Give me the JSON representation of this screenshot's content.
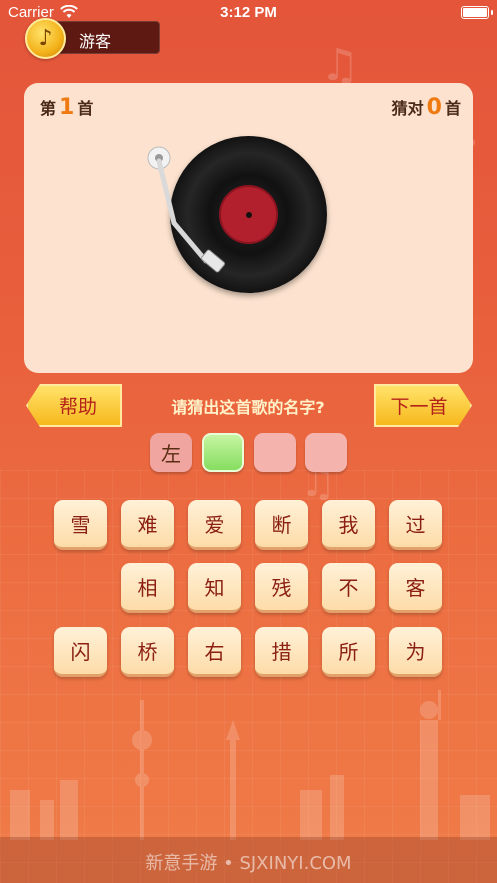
{
  "status_bar": {
    "carrier": "Carrier",
    "time": "3:12 PM"
  },
  "user": {
    "name": "游客",
    "avatar_icon": "music-note-icon"
  },
  "panel": {
    "current_prefix": "第",
    "current_number": "1",
    "current_suffix": "首",
    "correct_prefix": "猜对",
    "correct_number": "0",
    "correct_suffix": "首"
  },
  "controls": {
    "help_label": "帮助",
    "question": "请猜出这首歌的名字?",
    "next_label": "下一首"
  },
  "answer_slots": [
    "左",
    "",
    "",
    ""
  ],
  "tiles": {
    "row1": [
      "雪",
      "难",
      "爱",
      "断",
      "我",
      "过"
    ],
    "row2": [
      "相",
      "知",
      "残",
      "不",
      "客"
    ],
    "row3": [
      "闪",
      "桥",
      "右",
      "措",
      "所",
      "为"
    ]
  },
  "watermark": "新意手游 • SJXINYI.COM",
  "colors": {
    "accent_orange": "#f07a12",
    "button_yellow": "#f7b81c",
    "panel_bg": "#fde3cf",
    "active_slot_green": "#86dd60"
  }
}
